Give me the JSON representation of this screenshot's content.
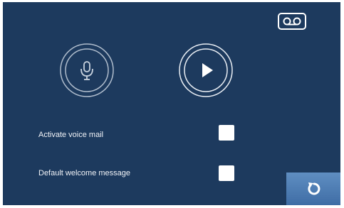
{
  "screen": {
    "background_color": "#1d3a5e",
    "accent_color": "#4f7fb6"
  },
  "header": {
    "voicemail_icon": "voicemail-icon"
  },
  "controls": {
    "record_icon": "microphone-icon",
    "play_icon": "play-icon"
  },
  "settings": [
    {
      "label": "Activate voice mail",
      "checked": false
    },
    {
      "label": "Default welcome message",
      "checked": false
    }
  ],
  "footer": {
    "back_icon": "refresh-back-icon"
  }
}
